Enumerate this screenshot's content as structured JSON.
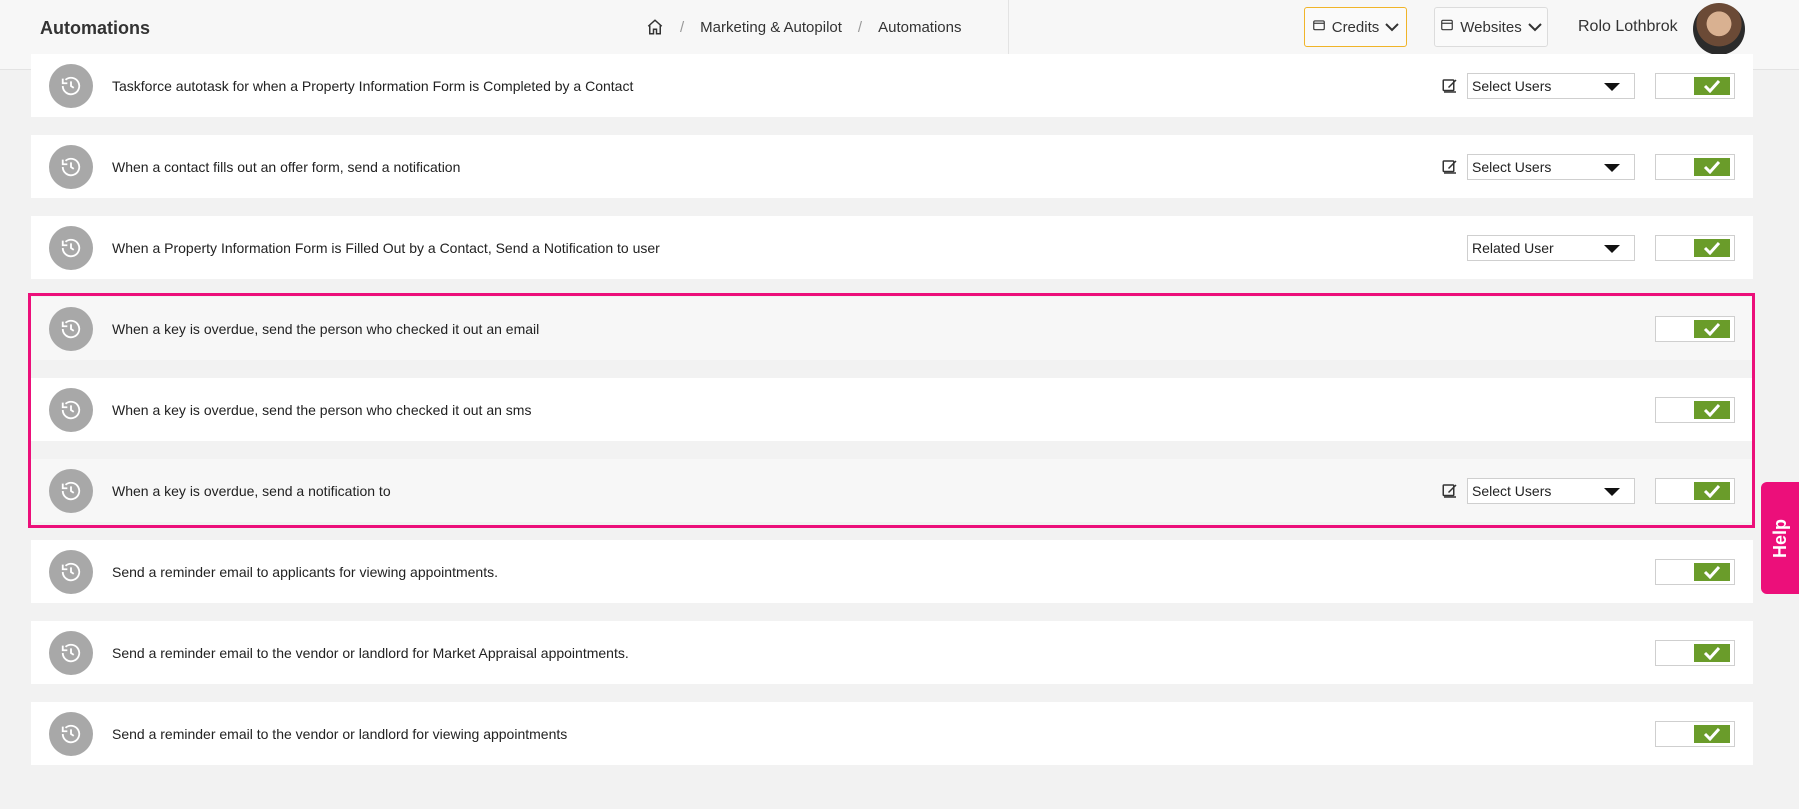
{
  "header": {
    "title": "Automations",
    "breadcrumb": {
      "items": [
        "Marketing & Autopilot",
        "Automations"
      ],
      "separator": "/"
    },
    "credits_label": "Credits",
    "websites_label": "Websites",
    "user_name": "Rolo Lothbrok"
  },
  "automations": [
    {
      "label": "Taskforce autotask for when a Property Information Form is Completed by a Contact",
      "has_edit": true,
      "select": "Select Users",
      "enabled": true
    },
    {
      "label": "When a contact fills out an offer form, send a notification",
      "has_edit": true,
      "select": "Select Users",
      "enabled": true
    },
    {
      "label": "When a Property Information Form is Filled Out by a Contact, Send a Notification to user",
      "has_edit": false,
      "select": "Related User",
      "enabled": true
    },
    {
      "label": "When a key is overdue, send the person who checked it out an email",
      "has_edit": false,
      "select": null,
      "enabled": true,
      "highlighted": true
    },
    {
      "label": "When a key is overdue, send the person who checked it out an sms",
      "has_edit": false,
      "select": null,
      "enabled": true,
      "highlighted": true
    },
    {
      "label": "When a key is overdue, send a notification to",
      "has_edit": true,
      "select": "Select Users",
      "enabled": true,
      "highlighted": true
    },
    {
      "label": "Send a reminder email to applicants for viewing appointments.",
      "has_edit": false,
      "select": null,
      "enabled": true
    },
    {
      "label": "Send a reminder email to the vendor or landlord for Market Appraisal appointments.",
      "has_edit": false,
      "select": null,
      "enabled": true
    },
    {
      "label": "Send a reminder email to the vendor or landlord for viewing appointments",
      "has_edit": false,
      "select": null,
      "enabled": true
    }
  ],
  "help_label": "Help",
  "colors": {
    "accent": "#ec0f7a",
    "toggle_on": "#6a9c2a",
    "credits_border": "#f0b429"
  }
}
